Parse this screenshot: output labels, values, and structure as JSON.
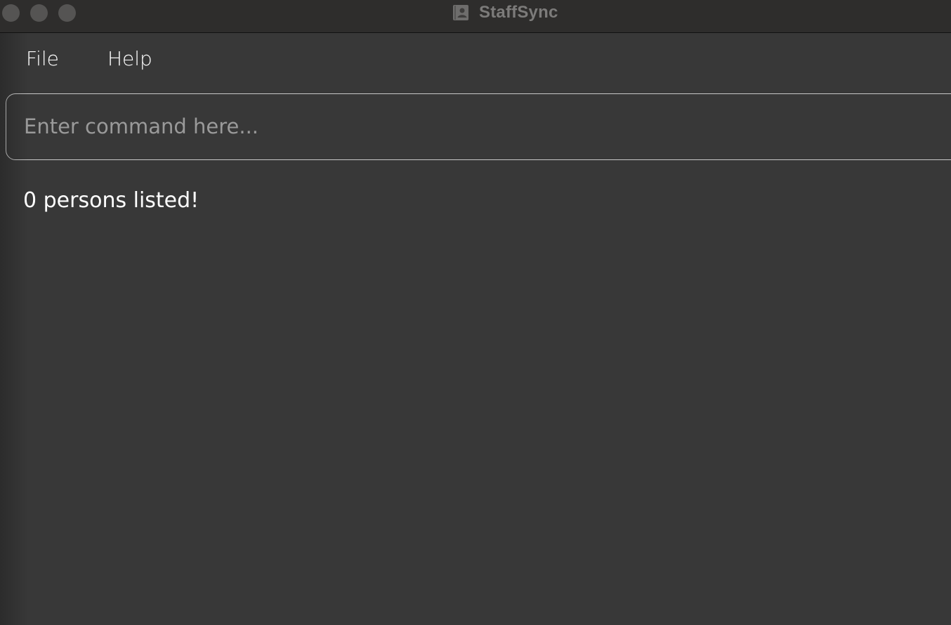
{
  "window": {
    "title": "StaffSync",
    "app_icon": "contact-book-icon"
  },
  "menu": {
    "items": [
      {
        "label": "File"
      },
      {
        "label": "Help"
      }
    ]
  },
  "command": {
    "placeholder": "Enter command here...",
    "value": ""
  },
  "result": {
    "message": "0 persons listed!"
  },
  "colors": {
    "background": "#383838",
    "titlebar": "#2e2d2c",
    "text": "#ffffff",
    "placeholder": "#9a9a9a",
    "border": "#c8c8c8"
  }
}
